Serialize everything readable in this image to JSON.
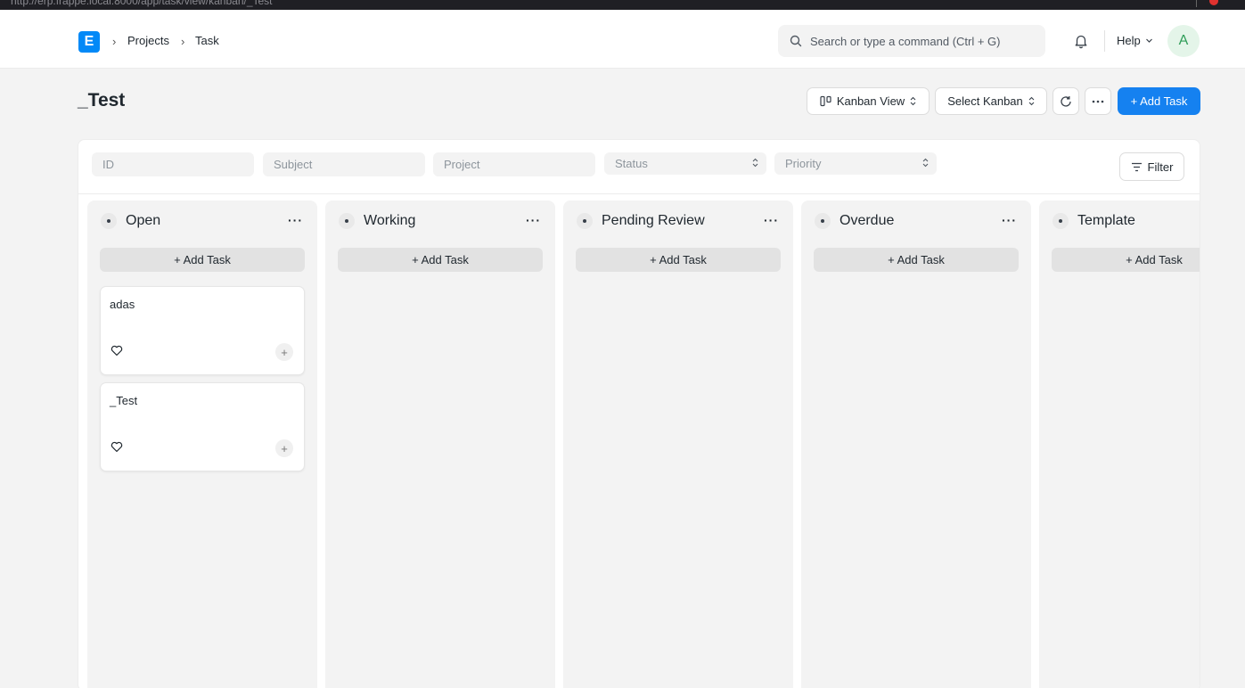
{
  "browser": {
    "url": "http://erp.frappe.local:8000/app/task/view/kanban/_Test"
  },
  "navbar": {
    "logo_letter": "E",
    "breadcrumbs": [
      "Projects",
      "Task"
    ],
    "search_placeholder": "Search or type a command (Ctrl + G)",
    "help_label": "Help",
    "avatar_initial": "A"
  },
  "page": {
    "title": "_Test",
    "view_label": "Kanban View",
    "select_kanban_label": "Select Kanban",
    "add_task_label": "+ Add Task"
  },
  "filters": {
    "fields": [
      "ID",
      "Subject",
      "Project",
      "Status",
      "Priority"
    ],
    "filter_label": "Filter"
  },
  "board": {
    "add_task_label": "+ Add Task",
    "columns": [
      {
        "title": "Open",
        "cards": [
          "adas",
          "_Test"
        ]
      },
      {
        "title": "Working",
        "cards": []
      },
      {
        "title": "Pending Review",
        "cards": []
      },
      {
        "title": "Overdue",
        "cards": []
      },
      {
        "title": "Template",
        "cards": []
      }
    ]
  },
  "colors": {
    "primary": "#1581f0",
    "logo": "#0289f7",
    "avatar_bg": "#e4f5e9",
    "avatar_text": "#2f9d58"
  }
}
